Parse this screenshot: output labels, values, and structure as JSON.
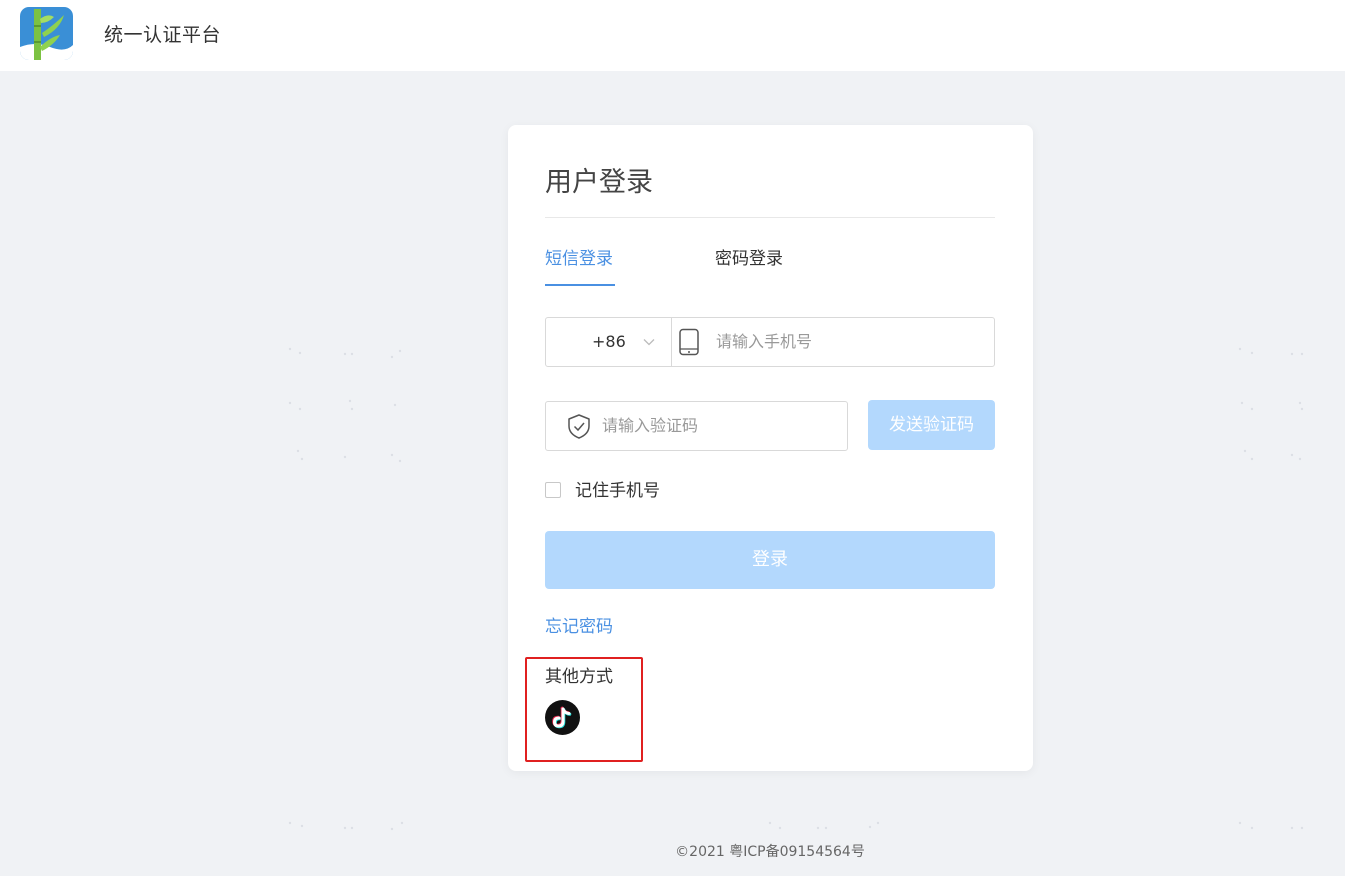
{
  "header": {
    "site_title": "统一认证平台",
    "logo_icon": "bamboo-logo-icon"
  },
  "login_card": {
    "title": "用户登录",
    "tabs": [
      {
        "label": "短信登录",
        "active": true
      },
      {
        "label": "密码登录",
        "active": false
      }
    ],
    "phone": {
      "country_code": "+86",
      "placeholder": "请输入手机号",
      "value": ""
    },
    "code": {
      "placeholder": "请输入验证码",
      "value": "",
      "send_label": "发送验证码"
    },
    "remember": {
      "label": "记住手机号",
      "checked": false
    },
    "login_label": "登录",
    "forgot_label": "忘记密码",
    "other": {
      "label": "其他方式",
      "icon": "tiktok-icon"
    }
  },
  "footer": {
    "copyright": "©2021 粤ICP备09154564号"
  },
  "colors": {
    "accent": "#4a90e2",
    "button_disabled": "#b3d8fd",
    "background": "#f0f2f5",
    "highlight_border": "#e02020"
  }
}
